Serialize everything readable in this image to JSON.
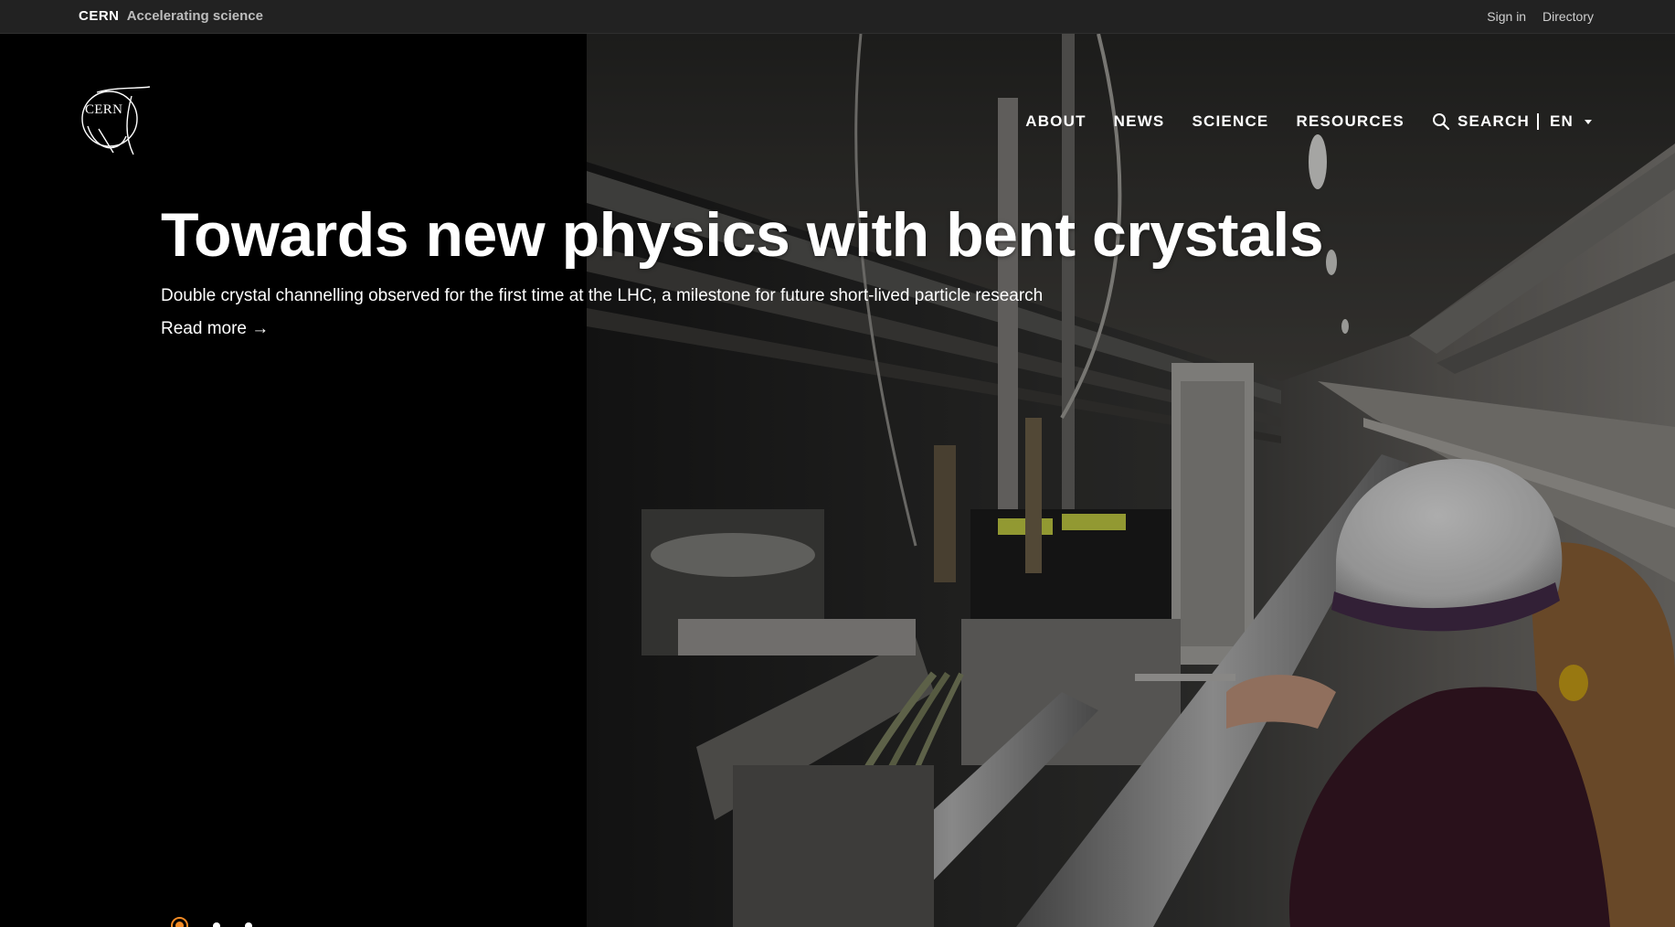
{
  "topbar": {
    "brand": "CERN",
    "tagline": "Accelerating science",
    "links": [
      "Sign in",
      "Directory"
    ]
  },
  "logo": {
    "text": "CERN"
  },
  "nav": {
    "items": [
      "ABOUT",
      "NEWS",
      "SCIENCE",
      "RESOURCES"
    ],
    "search_label": "SEARCH",
    "language": "EN"
  },
  "hero": {
    "title": "Towards new physics with bent crystals",
    "subtitle": "Double crystal channelling observed for the first time at the LHC, a milestone for future short-lived particle research",
    "read_more": "Read more →"
  },
  "carousel": {
    "slide_count": 3,
    "active_index": 0
  },
  "colors": {
    "accent": "#f28a24",
    "topbar": "#222222",
    "background": "#000000"
  }
}
